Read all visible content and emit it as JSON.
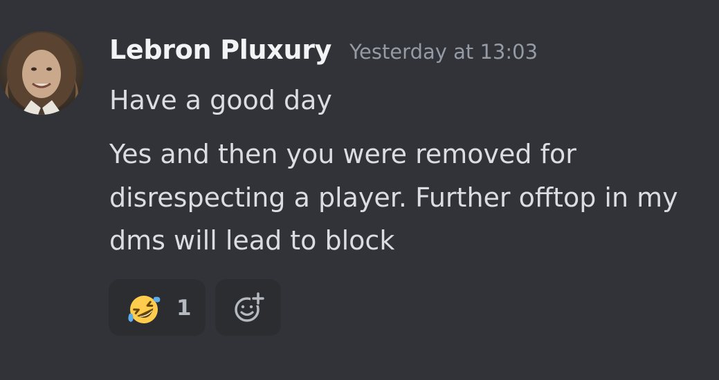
{
  "message": {
    "author": "Lebron Pluxury",
    "timestamp": "Yesterday at 13:03",
    "lines": [
      "Have a good day",
      "Yes and then you were removed for",
      "disrespecting a player. Further offtop in my",
      "dms will lead to block"
    ],
    "avatar": "user-avatar-photo"
  },
  "reactions": [
    {
      "emoji": "rolling-on-floor-laughing-emoji",
      "count": "1"
    }
  ],
  "add_reaction": {
    "icon": "smiley-plus-icon"
  },
  "colors": {
    "background": "#313338",
    "username": "#f2f3f5",
    "timestamp": "#949ba4",
    "text": "#dbdee1",
    "reaction_bg": "#2b2d31",
    "reaction_count": "#b5bac1"
  }
}
